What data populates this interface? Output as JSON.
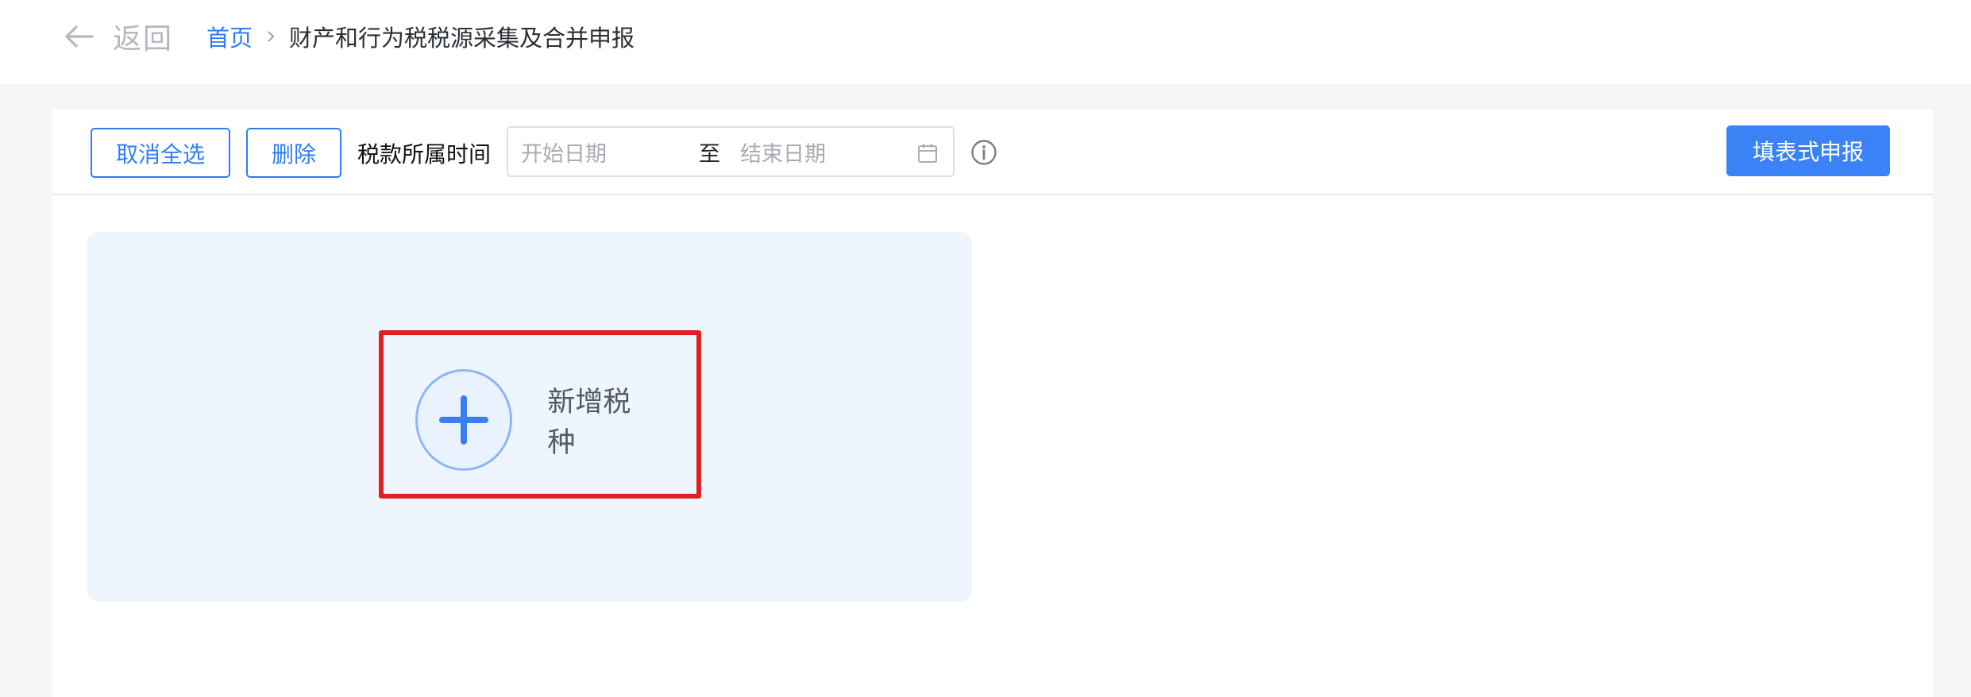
{
  "header": {
    "back_label": "返回",
    "breadcrumb": {
      "home": "首页",
      "current": "财产和行为税税源采集及合并申报"
    }
  },
  "toolbar": {
    "cancel_select_all": "取消全选",
    "delete": "删除",
    "tax_period_label": "税款所属时间",
    "date_range": {
      "start_placeholder": "开始日期",
      "separator": "至",
      "end_placeholder": "结束日期"
    },
    "fill_form_declare": "填表式申报"
  },
  "main": {
    "add_tax_type_label": "新增税种"
  },
  "icons": {
    "back": "arrow-left-icon",
    "breadcrumb_separator": "chevron-right-icon",
    "calendar": "calendar-icon",
    "info": "info-icon",
    "add": "plus-icon"
  },
  "colors": {
    "accent": "#2f7cf6",
    "primary_button": "#3b82f6",
    "highlight_border": "#e02020",
    "card_background": "#eef5fd"
  }
}
